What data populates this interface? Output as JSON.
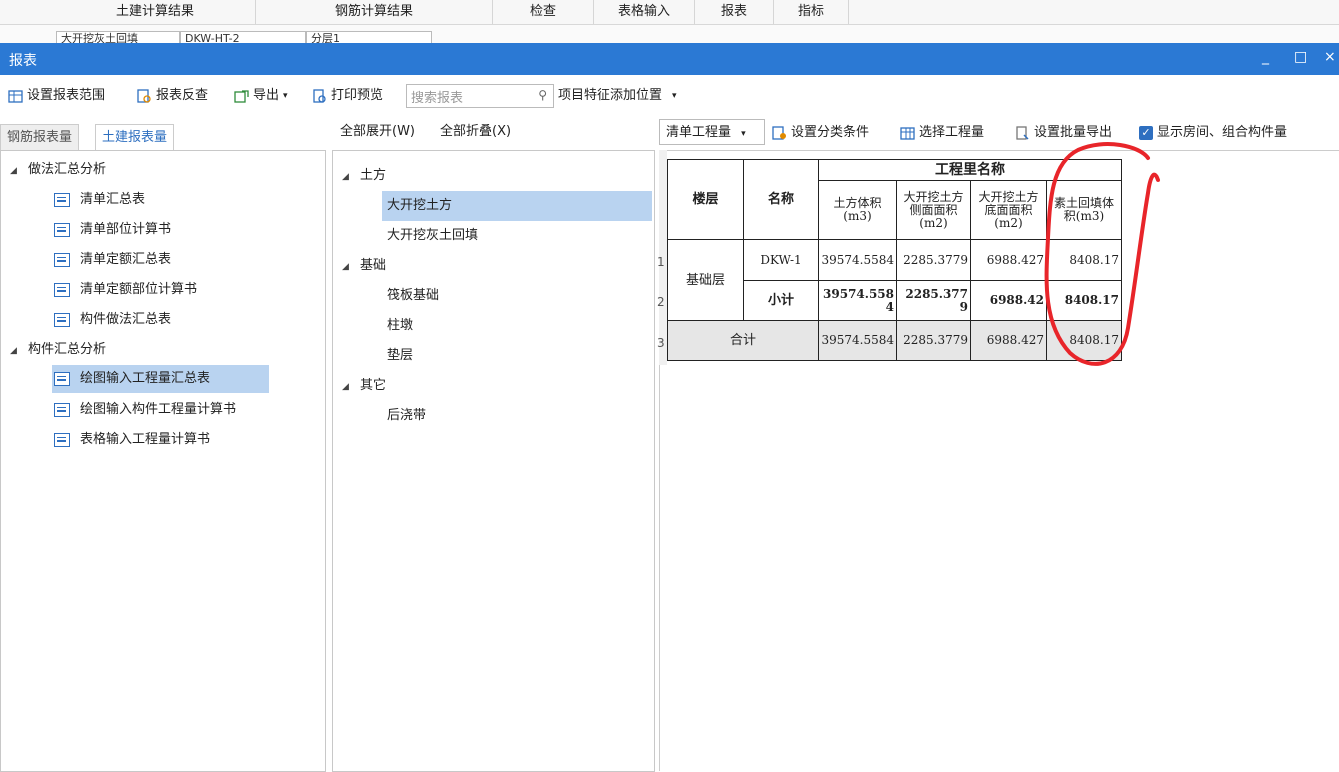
{
  "topnav": [
    "土建计算结果",
    "钢筋计算结果",
    "检查",
    "表格输入",
    "报表",
    "指标"
  ],
  "subnav": [
    "大开挖灰土回填",
    "DKW-HT-2",
    "分层1"
  ],
  "window": {
    "title": "报表",
    "min": "_",
    "max": "□",
    "close": "×"
  },
  "toolbar": {
    "set_range": "设置报表范围",
    "reverse": "报表反查",
    "export": "导出",
    "preview": "打印预览",
    "search_placeholder": "搜索报表",
    "feature_pos": "项目特征添加位置"
  },
  "left": {
    "tabs": [
      "钢筋报表量",
      "土建报表量"
    ],
    "groups": [
      {
        "label": "做法汇总分析",
        "items": [
          "清单汇总表",
          "清单部位计算书",
          "清单定额汇总表",
          "清单定额部位计算书",
          "构件做法汇总表"
        ]
      },
      {
        "label": "构件汇总分析",
        "items": [
          "绘图输入工程量汇总表",
          "绘图输入构件工程量计算书",
          "表格输入工程量计算书"
        ]
      }
    ]
  },
  "middle": {
    "expand_all": "全部展开(W)",
    "collapse_all": "全部折叠(X)",
    "groups": [
      {
        "label": "土方",
        "items": [
          "大开挖土方",
          "大开挖灰土回填"
        ]
      },
      {
        "label": "基础",
        "items": [
          "筏板基础",
          "柱墩",
          "垫层"
        ]
      },
      {
        "label": "其它",
        "items": [
          "后浇带"
        ]
      }
    ]
  },
  "right_toolbar": {
    "dropdown": "清单工程量",
    "classify": "设置分类条件",
    "select": "选择工程量",
    "batch_export": "设置批量导出",
    "show_rooms": "显示房间、组合构件量"
  },
  "report": {
    "header_group": "工程里名称",
    "col_floor": "楼层",
    "col_name": "名称",
    "cols": [
      "土方体积(m3)",
      "大开挖土方侧面面积(m2)",
      "大开挖土方底面面积(m2)",
      "素土回填体积(m3)"
    ],
    "floor": "基础层",
    "rows": [
      {
        "name": "DKW-1",
        "v1": "39574.5584",
        "v2": "2285.3779",
        "v3": "6988.427",
        "v4": "8408.17"
      },
      {
        "name": "小计",
        "v1": "39574.5584",
        "v2": "2285.3779",
        "v3": "6988.42",
        "v4": "8408.17"
      }
    ],
    "total": {
      "name": "合计",
      "v1": "39574.5584",
      "v2": "2285.3779",
      "v3": "6988.427",
      "v4": "8408.17"
    },
    "row_numbers": [
      "1",
      "2",
      "3"
    ]
  },
  "annotation_color": "#e8252a"
}
